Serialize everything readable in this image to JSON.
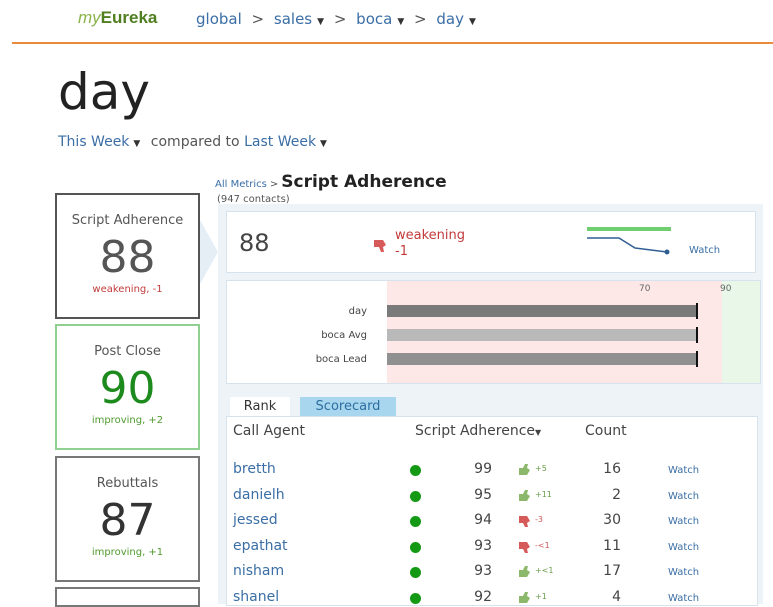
{
  "brand": {
    "my": "my",
    "eureka": "Eureka"
  },
  "breadcrumb": [
    {
      "label": "global",
      "dropdown": false
    },
    {
      "label": "sales",
      "dropdown": true
    },
    {
      "label": "boca",
      "dropdown": true
    },
    {
      "label": "day",
      "dropdown": true
    }
  ],
  "page_title": "day",
  "period": {
    "current": "This Week",
    "compared_text": "compared to",
    "previous": "Last Week"
  },
  "side_cards": [
    {
      "label": "Script Adherence",
      "value": "88",
      "status": "weakening, -1",
      "color": "#555555",
      "status_color": "#c23b3b"
    },
    {
      "label": "Post Close",
      "value": "90",
      "status": "improving, +2",
      "color": "#1c8a1c",
      "status_color": "#4f9a2f"
    },
    {
      "label": "Rebuttals",
      "value": "87",
      "status": "improving, +1",
      "color": "#333333",
      "status_color": "#4f9a2f"
    }
  ],
  "header": {
    "all_metrics": "All Metrics",
    "sep": ">",
    "metric": "Script Adherence",
    "contacts": "(947 contacts)"
  },
  "summary": {
    "value": "88",
    "trend": "weakening",
    "delta": "-1",
    "watch": "Watch"
  },
  "bar_chart": {
    "ticks": [
      "70",
      "90"
    ],
    "rows": [
      {
        "label": "day",
        "value": 88,
        "color": "#7a7a7a"
      },
      {
        "label": "boca Avg",
        "value": 88,
        "color": "#b9b9b9"
      },
      {
        "label": "boca Lead",
        "value": 88,
        "color": "#909090"
      }
    ]
  },
  "tabs": {
    "rank": "Rank",
    "scorecard": "Scorecard"
  },
  "table": {
    "headers": {
      "agent": "Call Agent",
      "adherence": "Script Adherence",
      "count": "Count"
    },
    "rows": [
      {
        "agent": "bretth",
        "score": "99",
        "thumb": "up",
        "delta": "+5",
        "count": "16",
        "watch": "Watch"
      },
      {
        "agent": "danielh",
        "score": "95",
        "thumb": "up",
        "delta": "+11",
        "count": "2",
        "watch": "Watch"
      },
      {
        "agent": "jessed",
        "score": "94",
        "thumb": "down",
        "delta": "-3",
        "count": "30",
        "watch": "Watch"
      },
      {
        "agent": "epathat",
        "score": "93",
        "thumb": "down",
        "delta": "-<1",
        "count": "11",
        "watch": "Watch"
      },
      {
        "agent": "nisham",
        "score": "93",
        "thumb": "up",
        "delta": "+<1",
        "count": "17",
        "watch": "Watch"
      },
      {
        "agent": "shanel",
        "score": "92",
        "thumb": "up",
        "delta": "+1",
        "count": "4",
        "watch": "Watch"
      }
    ]
  },
  "colors": {
    "accent_orange": "#e98b3a",
    "link_blue": "#3a6ea5",
    "good_green": "#139913",
    "bad_red": "#c23b3b"
  }
}
